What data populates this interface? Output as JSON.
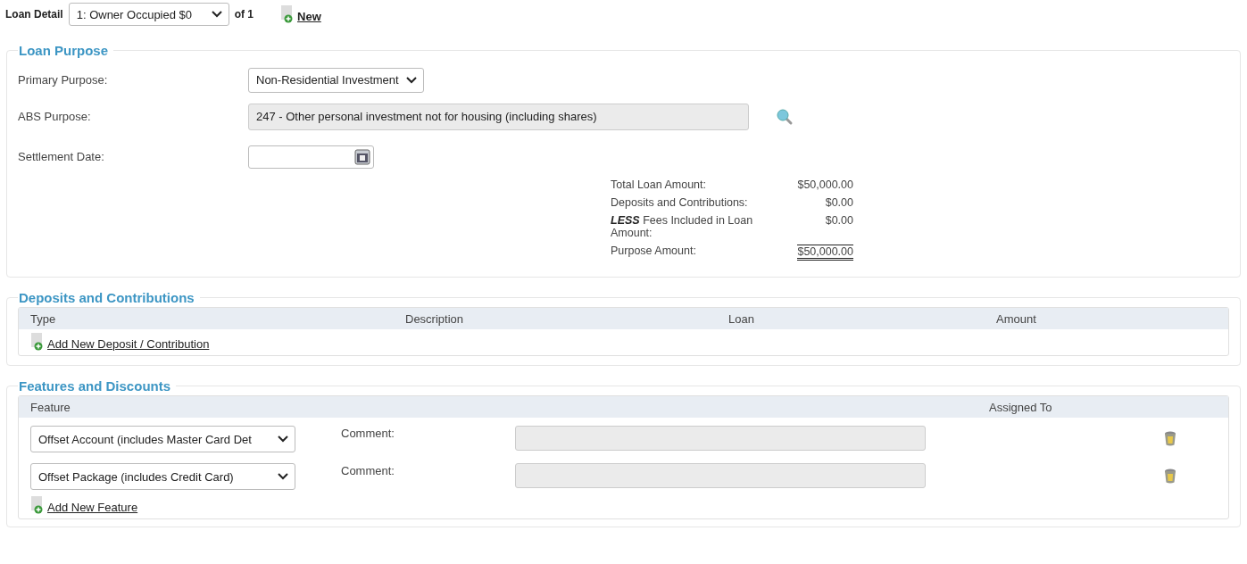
{
  "loan_detail": {
    "label": "Loan Detail",
    "selector": "1: Owner Occupied $0",
    "of_text": "of 1",
    "new_link": "New"
  },
  "loan_purpose": {
    "title": "Loan Purpose",
    "fields": [
      {
        "kind": "select",
        "label": "Primary Purpose:",
        "value": "Non-Residential Investment"
      },
      {
        "kind": "lookup",
        "label": "ABS Purpose:",
        "value": "247 - Other personal investment not for housing (including shares)"
      },
      {
        "kind": "date",
        "label": "Settlement Date:"
      }
    ],
    "summary": [
      {
        "label": "Total Loan Amount:",
        "value": "$50,000.00",
        "total": false
      },
      {
        "label": "Deposits and Contributions:",
        "value": "$0.00",
        "total": false
      },
      {
        "label": "**LESS** Fees Included in Loan Amount:",
        "value": "$0.00",
        "total": false
      },
      {
        "label": "Purpose Amount:",
        "value": "$50,000.00",
        "total": true
      }
    ]
  },
  "deposits": {
    "title": "Deposits and Contributions",
    "columns": [
      "Type",
      "Description",
      "Loan",
      "Amount"
    ],
    "add_link": "Add New Deposit / Contribution"
  },
  "features": {
    "title": "Features and Discounts",
    "columns": [
      "Feature",
      "Assigned To"
    ],
    "rows": [
      {
        "feature": "Offset Account (includes Master Card Det",
        "comment_label": "Comment:"
      },
      {
        "feature": "Offset Package (includes Credit Card)",
        "comment_label": "Comment:"
      }
    ],
    "add_link": "Add New Feature"
  }
}
